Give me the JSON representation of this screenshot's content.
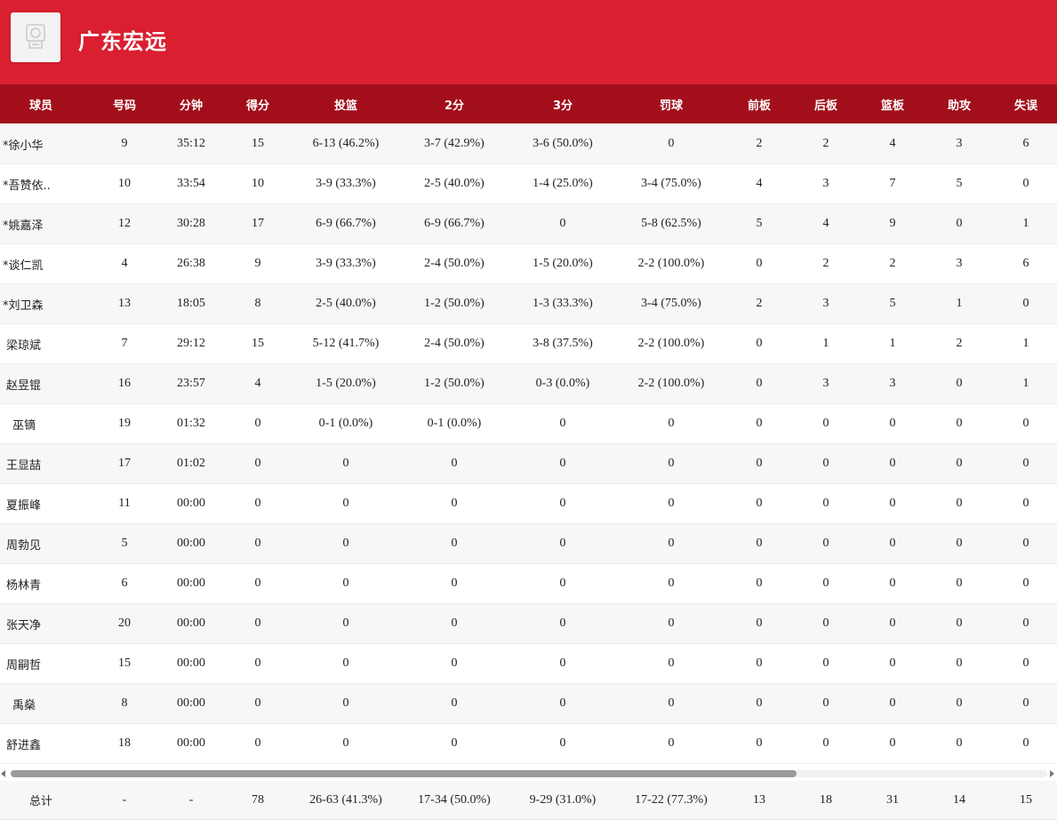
{
  "team": {
    "name": "广东宏远",
    "logo_icon": "team-logo-icon"
  },
  "colors": {
    "header_bg": "#d91f30",
    "table_header_bg": "#a20f1b"
  },
  "columns": [
    "球员",
    "号码",
    "分钟",
    "得分",
    "投篮",
    "2分",
    "3分",
    "罚球",
    "前板",
    "后板",
    "篮板",
    "助攻",
    "失误"
  ],
  "players": [
    [
      "*徐小华",
      "9",
      "35:12",
      "15",
      "6-13 (46.2%)",
      "3-7 (42.9%)",
      "3-6 (50.0%)",
      "0",
      "2",
      "2",
      "4",
      "3",
      "6"
    ],
    [
      "*吾赞依..",
      "10",
      "33:54",
      "10",
      "3-9 (33.3%)",
      "2-5 (40.0%)",
      "1-4 (25.0%)",
      "3-4 (75.0%)",
      "4",
      "3",
      "7",
      "5",
      "0"
    ],
    [
      "*姚嘉泽",
      "12",
      "30:28",
      "17",
      "6-9 (66.7%)",
      "6-9 (66.7%)",
      "0",
      "5-8 (62.5%)",
      "5",
      "4",
      "9",
      "0",
      "1"
    ],
    [
      "*谈仁凯",
      "4",
      "26:38",
      "9",
      "3-9 (33.3%)",
      "2-4 (50.0%)",
      "1-5 (20.0%)",
      "2-2 (100.0%)",
      "0",
      "2",
      "2",
      "3",
      "6"
    ],
    [
      "*刘卫森",
      "13",
      "18:05",
      "8",
      "2-5 (40.0%)",
      "1-2 (50.0%)",
      "1-3 (33.3%)",
      "3-4 (75.0%)",
      "2",
      "3",
      "5",
      "1",
      "0"
    ],
    [
      "梁琼斌",
      "7",
      "29:12",
      "15",
      "5-12 (41.7%)",
      "2-4 (50.0%)",
      "3-8 (37.5%)",
      "2-2 (100.0%)",
      "0",
      "1",
      "1",
      "2",
      "1"
    ],
    [
      "赵昱锟",
      "16",
      "23:57",
      "4",
      "1-5 (20.0%)",
      "1-2 (50.0%)",
      "0-3 (0.0%)",
      "2-2 (100.0%)",
      "0",
      "3",
      "3",
      "0",
      "1"
    ],
    [
      "巫镝",
      "19",
      "01:32",
      "0",
      "0-1 (0.0%)",
      "0-1 (0.0%)",
      "0",
      "0",
      "0",
      "0",
      "0",
      "0",
      "0"
    ],
    [
      "王显喆",
      "17",
      "01:02",
      "0",
      "0",
      "0",
      "0",
      "0",
      "0",
      "0",
      "0",
      "0",
      "0"
    ],
    [
      "夏振峰",
      "11",
      "00:00",
      "0",
      "0",
      "0",
      "0",
      "0",
      "0",
      "0",
      "0",
      "0",
      "0"
    ],
    [
      "周勃见",
      "5",
      "00:00",
      "0",
      "0",
      "0",
      "0",
      "0",
      "0",
      "0",
      "0",
      "0",
      "0"
    ],
    [
      "杨林青",
      "6",
      "00:00",
      "0",
      "0",
      "0",
      "0",
      "0",
      "0",
      "0",
      "0",
      "0",
      "0"
    ],
    [
      "张天净",
      "20",
      "00:00",
      "0",
      "0",
      "0",
      "0",
      "0",
      "0",
      "0",
      "0",
      "0",
      "0"
    ],
    [
      "周嗣哲",
      "15",
      "00:00",
      "0",
      "0",
      "0",
      "0",
      "0",
      "0",
      "0",
      "0",
      "0",
      "0"
    ],
    [
      "禹燊",
      "8",
      "00:00",
      "0",
      "0",
      "0",
      "0",
      "0",
      "0",
      "0",
      "0",
      "0",
      "0"
    ],
    [
      "舒进鑫",
      "18",
      "00:00",
      "0",
      "0",
      "0",
      "0",
      "0",
      "0",
      "0",
      "0",
      "0",
      "0"
    ]
  ],
  "totals": [
    "总计",
    "-",
    "-",
    "78",
    "26-63 (41.3%)",
    "17-34 (50.0%)",
    "9-29 (31.0%)",
    "17-22 (77.3%)",
    "13",
    "18",
    "31",
    "14",
    "15"
  ]
}
